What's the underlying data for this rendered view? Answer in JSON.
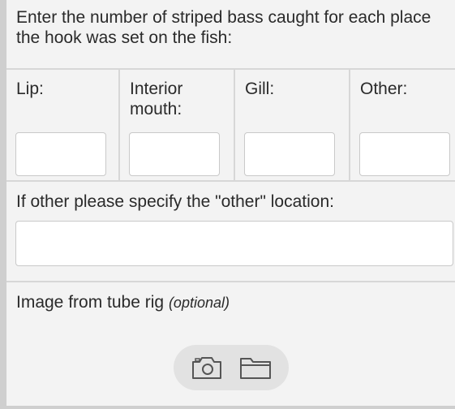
{
  "question_counts": {
    "prompt": "Enter the number of striped bass caught for each place the hook was set on the fish:",
    "columns": [
      {
        "label": "Lip:",
        "value": ""
      },
      {
        "label": "Interior mouth:",
        "value": ""
      },
      {
        "label": "Gill:",
        "value": ""
      },
      {
        "label": "Other:",
        "value": ""
      }
    ]
  },
  "question_other": {
    "label": "If other please specify the \"other\" location:",
    "value": ""
  },
  "question_image": {
    "label": "Image from tube rig",
    "optional": "(optional)",
    "icons": [
      "camera-icon",
      "folder-icon"
    ]
  }
}
